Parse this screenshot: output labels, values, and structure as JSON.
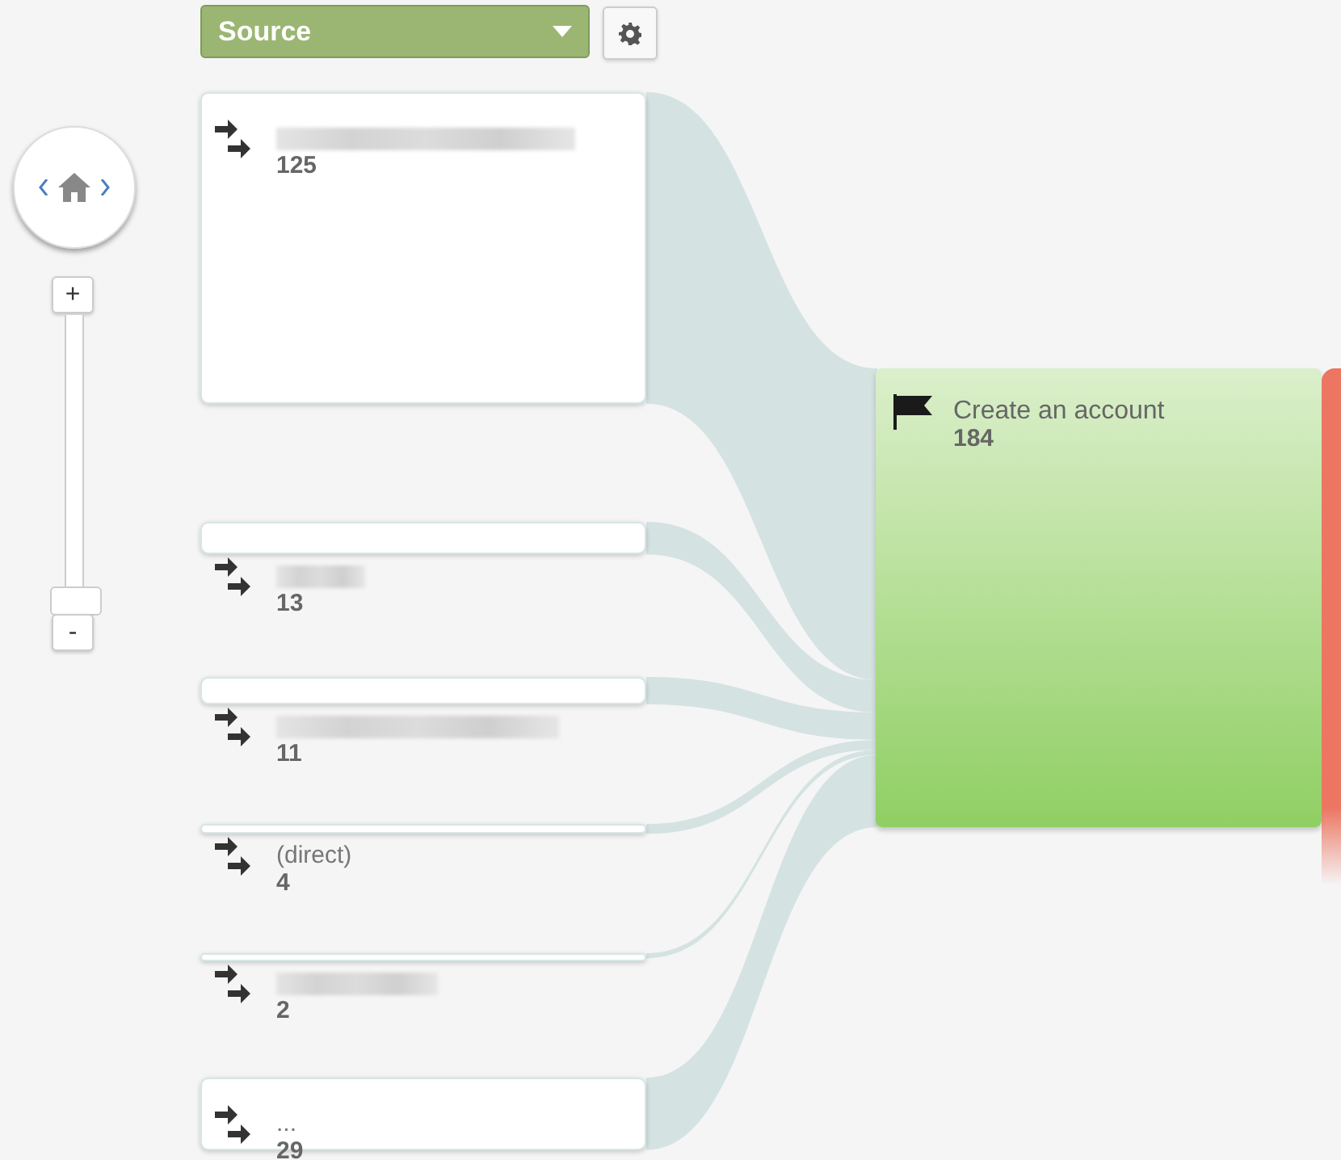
{
  "dimension_menu": {
    "label": "Source"
  },
  "zoom": {
    "in_label": "+",
    "out_label": "-",
    "level": 0
  },
  "source_nodes": [
    {
      "label_blurred": true,
      "count": "125"
    },
    {
      "label_blurred": true,
      "count": "13"
    },
    {
      "label_blurred": true,
      "count": "11"
    },
    {
      "label": "(direct)",
      "count": "4"
    },
    {
      "label_blurred": true,
      "count": "2"
    },
    {
      "label": "...",
      "count": "29"
    }
  ],
  "goal_node": {
    "label": "Create an account",
    "count": "184"
  }
}
